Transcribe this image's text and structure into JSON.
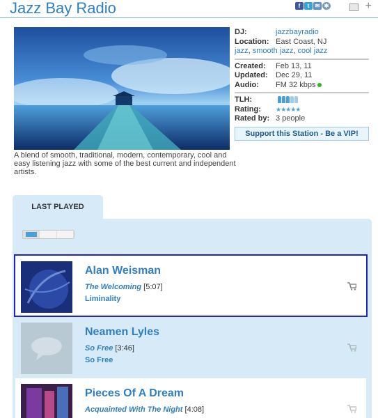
{
  "header": {
    "title": "Jazz Bay Radio",
    "share_icons": [
      "facebook-icon",
      "twitter-icon",
      "email-icon",
      "settings-icon"
    ],
    "plus": "+"
  },
  "station": {
    "description": "A blend of smooth, traditional, modern, contemporary, cool and easy listening jazz with some of the best current and independent artists."
  },
  "info": {
    "dj_label": "DJ:",
    "dj_value": "jazzbayradio",
    "location_label": "Location:",
    "location_value": "East Coast, NJ",
    "genres": [
      "jazz",
      "smooth jazz",
      "cool jazz"
    ],
    "created_label": "Created:",
    "created_value": "Feb 13, 11",
    "updated_label": "Updated:",
    "updated_value": "Dec 29, 11",
    "audio_label": "Audio:",
    "audio_value": "FM 32 kbps",
    "tlh_label": "TLH:",
    "tlh_level": 0.6,
    "rating_label": "Rating:",
    "rating_stars": 5,
    "rated_by_label": "Rated by:",
    "rated_by_value": "3 people",
    "vip_button": "Support this Station - Be a VIP!"
  },
  "last_played": {
    "tab_label": "LAST PLAYED",
    "tracks": [
      {
        "artist": "Alan Weisman",
        "title": "The Welcoming",
        "duration": "[5:07]",
        "album": "Liminality"
      },
      {
        "artist": "Neamen Lyles",
        "title": "So Free",
        "duration": "[3:46]",
        "album": "So Free"
      },
      {
        "artist": "Pieces Of A Dream",
        "title": "Acquainted With The Night",
        "duration": "[4:08]",
        "album": ""
      }
    ]
  },
  "colors": {
    "accent": "#2f7fc1",
    "panel": "#d6ebf7",
    "selection": "#2023c8",
    "status_online": "#2ab52a"
  }
}
